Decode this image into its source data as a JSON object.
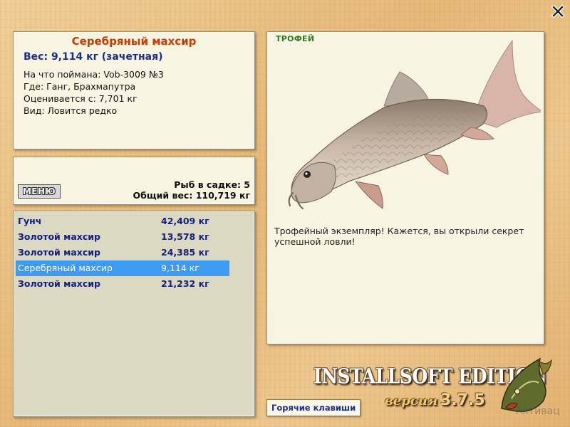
{
  "info": {
    "title": "Серебряный махсир",
    "weight": "Вес: 9,114 кг (зачетная)",
    "bait": "На что поймана: Vob-3009 №3",
    "where": "Где: Ганг, Брахмапутра",
    "price": "Оценивается с: 7,701 кг",
    "kind": "Вид: Ловится редко"
  },
  "summary": {
    "menu_label": "МЕНЮ",
    "fish_count": "Рыб в садке: 5",
    "total_weight": "Общий вес: 110,719 кг"
  },
  "catch_list": [
    {
      "name": "Гунч",
      "weight": "42,409 кг"
    },
    {
      "name": "Золотой махсир",
      "weight": "13,578 кг"
    },
    {
      "name": "Золотой махсир",
      "weight": "24,385 кг"
    },
    {
      "name": "Серебряный махсир",
      "weight": "9,114 кг",
      "selected": true
    },
    {
      "name": "Золотой махсир",
      "weight": "21,232 кг"
    }
  ],
  "detail": {
    "label": "ТРОФЕЙ",
    "text": "Трофейный экземпляр! Кажется, вы открыли секрет успешной ловли!"
  },
  "footer": {
    "hotkeys_label": "Горячие клавиши",
    "edition": "INSTALLSOFT EDITION",
    "version_label": "версия",
    "version_number": "3.7.5",
    "watermark": "Активац"
  },
  "icons": {
    "close": "close-icon",
    "fish": "fish-image",
    "logo": "pike-logo"
  },
  "colors": {
    "title": "#c83c00",
    "weight": "#1a2f8c",
    "selected_row": "#3f9bf2",
    "trophy": "#2c7a24"
  }
}
